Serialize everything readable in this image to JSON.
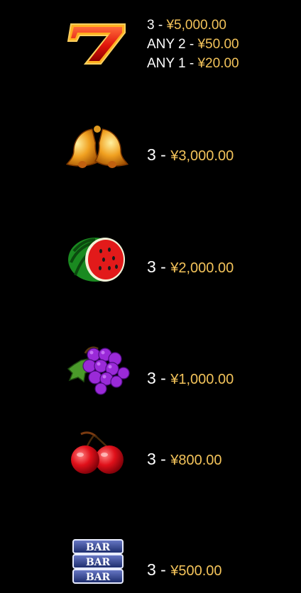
{
  "paytable": {
    "seven": {
      "icon": "seven-icon",
      "lines": [
        {
          "count": "3",
          "amount": "¥5,000.00"
        },
        {
          "count": "ANY 2",
          "amount": "¥50.00"
        },
        {
          "count": "ANY 1",
          "amount": "¥20.00"
        }
      ]
    },
    "bell": {
      "icon": "bell-icon",
      "count": "3",
      "amount": "¥3,000.00"
    },
    "watermelon": {
      "icon": "watermelon-icon",
      "count": "3",
      "amount": "¥2,000.00"
    },
    "grape": {
      "icon": "grape-icon",
      "count": "3",
      "amount": "¥1,000.00"
    },
    "cherry": {
      "icon": "cherry-icon",
      "count": "3",
      "amount": "¥800.00"
    },
    "bar": {
      "icon": "bar-icon",
      "symbol_text": [
        "BAR",
        "BAR",
        "BAR"
      ],
      "count": "3",
      "amount": "¥500.00"
    }
  },
  "separator": " - ",
  "colors": {
    "background": "#000000",
    "count_text": "#ffffff",
    "amount_text": "#f3c35a"
  }
}
